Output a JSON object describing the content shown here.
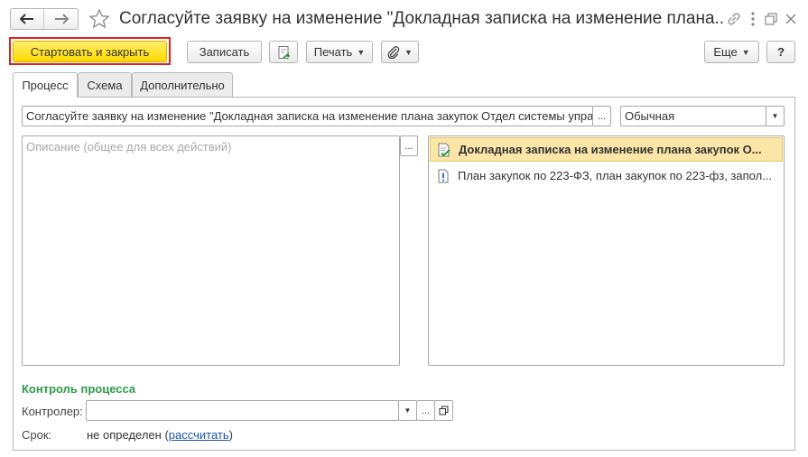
{
  "window": {
    "title": "Согласуйте заявку на изменение \"Докладная записка на изменение плана...",
    "back_icon": "arrow-left-icon",
    "forward_icon": "arrow-right-icon",
    "star_icon": "star-outline-icon",
    "link_icon": "link-icon",
    "menu_icon": "vertical-dots-icon",
    "restore_icon": "restore-window-icon",
    "close_icon": "close-icon"
  },
  "toolbar": {
    "start_close_label": "Стартовать и закрыть",
    "save_label": "Записать",
    "print_label": "Печать",
    "more_label": "Еще",
    "help_label": "?"
  },
  "tabs": [
    {
      "label": "Процесс",
      "active": true
    },
    {
      "label": "Схема",
      "active": false
    },
    {
      "label": "Дополнительно",
      "active": false
    }
  ],
  "form": {
    "subject_value": "Согласуйте заявку на изменение \"Докладная записка на изменение плана закупок Отдел системы упра",
    "subject_button": "...",
    "priority_value": "Обычная",
    "description_placeholder": "Описание (общее для всех действий)",
    "description_button": "..."
  },
  "attachments": [
    {
      "label": "Докладная записка на изменение плана закупок О...",
      "icon": "document-check-icon",
      "selected": true
    },
    {
      "label": "План закупок по 223-ФЗ, план закупок по 223-фз, запол...",
      "icon": "document-exclamation-icon",
      "selected": false
    }
  ],
  "control": {
    "heading": "Контроль процесса",
    "controller_label": "Контролер:",
    "controller_value": "",
    "due_label": "Срок:",
    "due_value": "не определен (",
    "due_link": "рассчитать",
    "due_close": ")"
  },
  "colors": {
    "accent_yellow": "#ffe23a",
    "highlight_border": "#e0201b",
    "selected_row": "#fbe5a7",
    "heading_green": "#2f9a48",
    "link_blue": "#1a55a8"
  }
}
